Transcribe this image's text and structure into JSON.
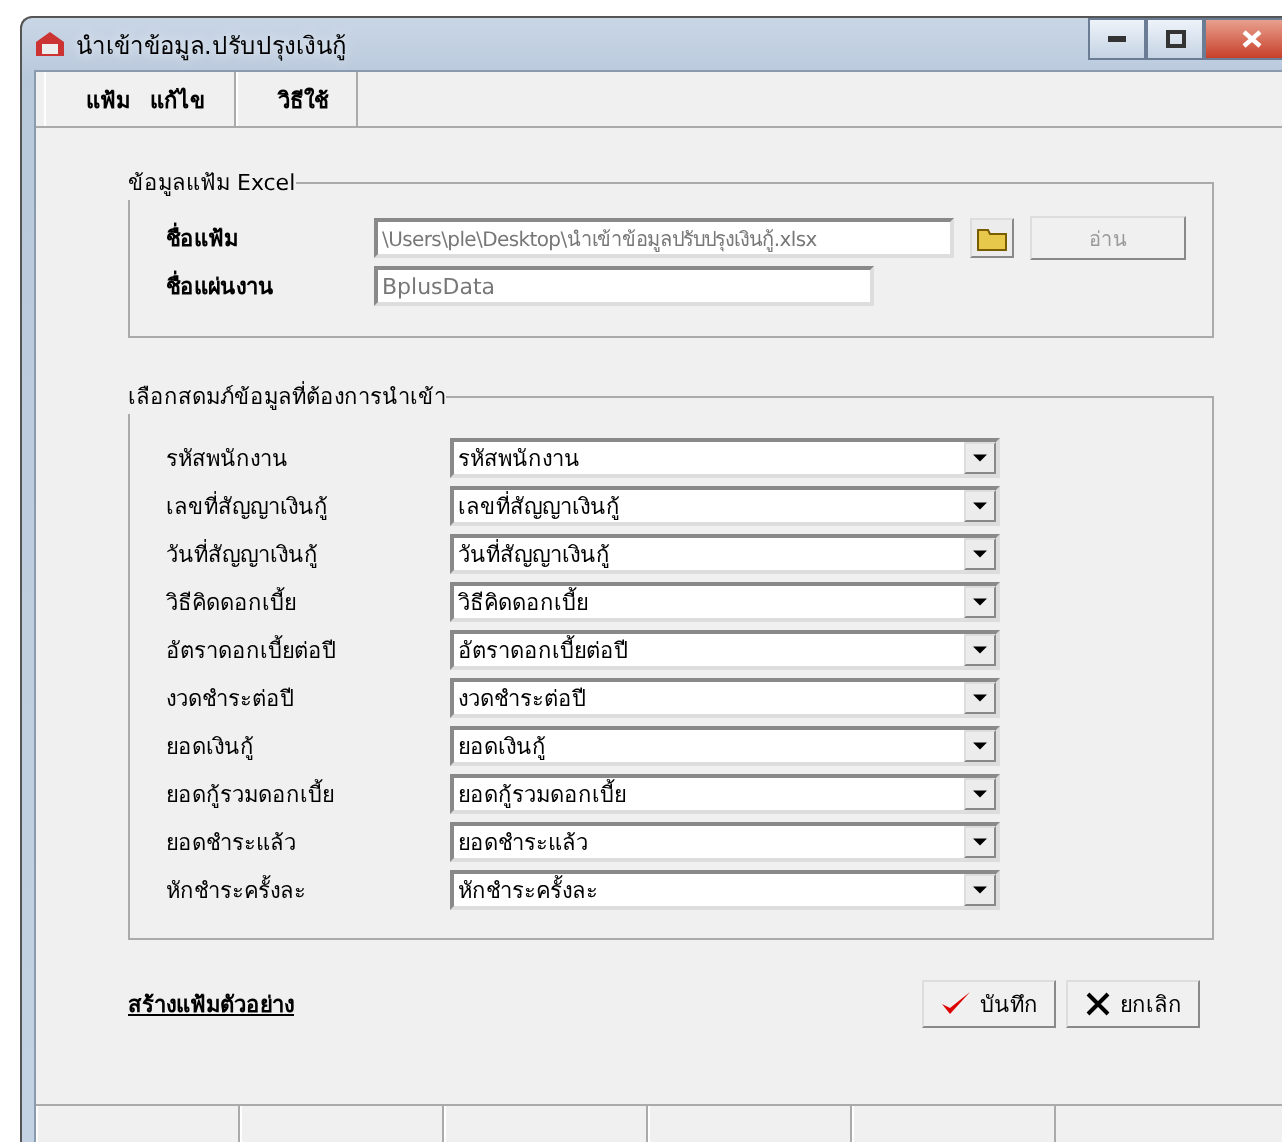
{
  "window": {
    "title": "นำเข้าข้อมูล.ปรับปรุงเงินกู้"
  },
  "menu": [
    {
      "label": "แฟ้ม"
    },
    {
      "label": "แก้ไข"
    },
    {
      "label": "วิธีใช้"
    }
  ],
  "excel_group": {
    "title": "ข้อมูลแฟ้ม Excel",
    "file_label": "ชื่อแฟ้ม",
    "file_value": "\\Users\\ple\\Desktop\\นำเข้าข้อมูลปรับปรุงเงินกู้.xlsx",
    "file_disabled": true,
    "read_button": {
      "label": "อ่าน",
      "disabled": true
    },
    "sheet_label": "ชื่อแผ่นงาน",
    "sheet_value": "BplusData",
    "sheet_disabled": true
  },
  "columns_group": {
    "title": "เลือกสดมภ์ข้อมูลที่ต้องการนำเข้า",
    "rows": [
      {
        "label": "รหัสพนักงาน",
        "value": "รหัสพนักงาน"
      },
      {
        "label": "เลขที่สัญญาเงินกู้",
        "value": "เลขที่สัญญาเงินกู้"
      },
      {
        "label": "วันที่สัญญาเงินกู้",
        "value": "วันที่สัญญาเงินกู้"
      },
      {
        "label": "วิธีคิดดอกเบี้ย",
        "value": "วิธีคิดดอกเบี้ย"
      },
      {
        "label": "อัตราดอกเบี้ยต่อปี",
        "value": "อัตราดอกเบี้ยต่อปี"
      },
      {
        "label": "งวดชำระต่อปี",
        "value": "งวดชำระต่อปี"
      },
      {
        "label": "ยอดเงินกู้",
        "value": "ยอดเงินกู้"
      },
      {
        "label": "ยอดกู้รวมดอกเบี้ย",
        "value": "ยอดกู้รวมดอกเบี้ย"
      },
      {
        "label": "ยอดชำระแล้ว",
        "value": "ยอดชำระแล้ว"
      },
      {
        "label": "หักชำระครั้งละ",
        "value": "หักชำระครั้งละ"
      }
    ]
  },
  "sample_link": "สร้างแฟ้มตัวอย่าง",
  "buttons": [
    {
      "kind": "save",
      "label": "บันทึก"
    },
    {
      "kind": "cancel",
      "label": "ยกเลิก"
    }
  ]
}
